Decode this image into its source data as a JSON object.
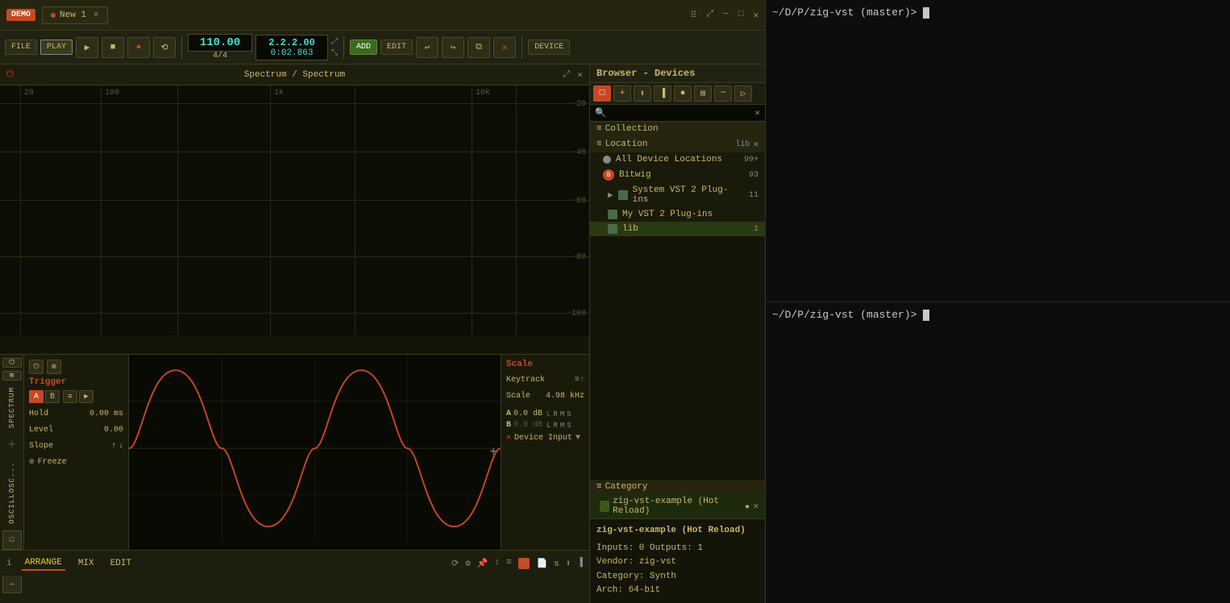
{
  "app": {
    "demo_label": "DEMO",
    "tab_title": "New 1",
    "tab_modified": true
  },
  "transport": {
    "file_label": "FILE",
    "play_label": "PLAY",
    "bpm": "110.00",
    "time_sig": "4/4",
    "position": "2.2.2.00",
    "elapsed": "0:02.863",
    "add_label": "ADD",
    "edit_label": "EDIT",
    "device_label": "DEVICE"
  },
  "spectrum": {
    "title": "Spectrum / Spectrum",
    "freq_labels": [
      "20",
      "100",
      "1k",
      "10k"
    ],
    "db_labels": [
      "-20",
      "-40",
      "-60",
      "-80",
      "-100"
    ]
  },
  "oscilloscope": {
    "title": "Trigger",
    "hold_label": "Hold",
    "hold_value": "0.00 ms",
    "level_label": "Level",
    "level_value": "0.00",
    "slope_label": "Slope",
    "freeze_label": "Freeze",
    "scale_title": "Scale",
    "keytrack_label": "Keytrack",
    "scale_label": "Scale",
    "scale_value": "4.98 kHz",
    "ch_a": "A",
    "ch_b": "B",
    "ch_a_db": "0.0 dB",
    "ch_b_db": "0.0 dB",
    "device_input": "Device Input"
  },
  "panel_tabs": {
    "spectrum_label": "SPECTRUM",
    "oscillosc_label": "OSCILLOSC..."
  },
  "browser": {
    "title": "Browser - Devices",
    "collection_label": "Collection",
    "location_label": "Location",
    "lib_label": "lib",
    "close_label": "×",
    "all_device_locations": "All Device Locations",
    "all_count": "99+",
    "bitwig_label": "Bitwig",
    "bitwig_count": "93",
    "system_vst2": "System VST 2 Plug-ins",
    "system_vst2_count": "11",
    "my_vst2": "My VST 2 Plug-ins",
    "lib_item": "lib",
    "lib_count": "1",
    "category_label": "Category",
    "category_item": "zig-vst-example (Hot Reload)",
    "device_info": {
      "name": "zig-vst-example (Hot Reload)",
      "inputs": "Inputs: 0   Outputs: 1",
      "vendor": "Vendor: zig-vst",
      "category": "Category: Synth",
      "arch": "Arch: 64-bit"
    }
  },
  "status_bar": {
    "info_icon": "i",
    "arrange_label": "ARRANGE",
    "mix_label": "MIX",
    "edit_label": "EDIT"
  },
  "terminal": {
    "top_prompt": "~/D/P/zig-vst (master)> ",
    "bottom_prompt": "~/D/P/zig-vst (master)> "
  }
}
